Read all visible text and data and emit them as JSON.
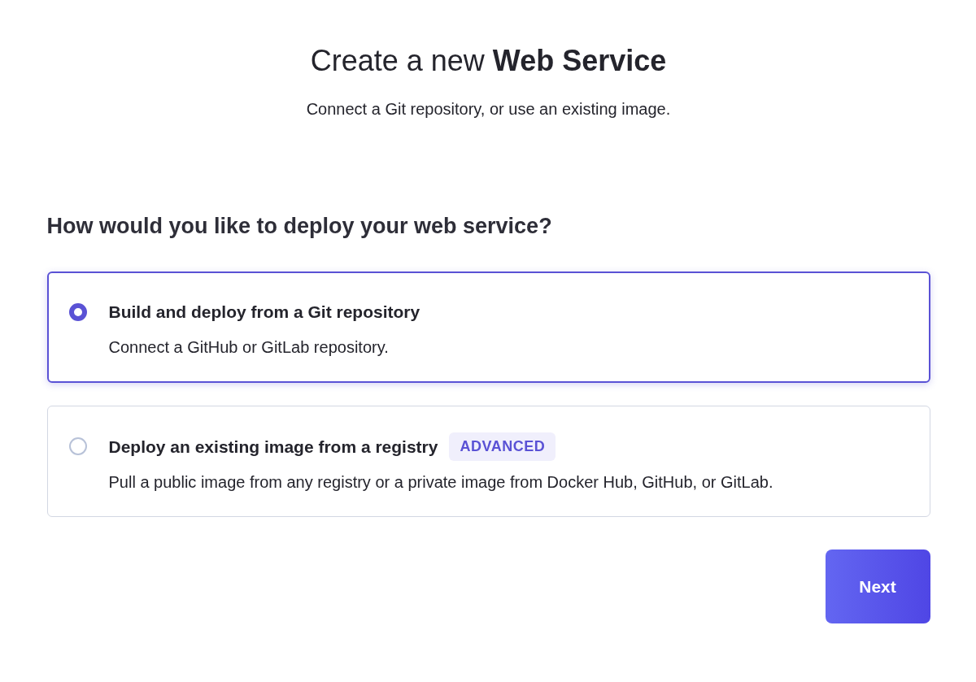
{
  "header": {
    "title": "Create a new **Web Service**",
    "subtitle": "Connect a Git repository, or use an existing image."
  },
  "question": "How would you like to deploy your web service?",
  "options": [
    {
      "title": "Build and deploy from a Git repository",
      "description": "Connect a GitHub or GitLab repository.",
      "selected": true
    },
    {
      "title": "Deploy an existing image from a registry",
      "badge": "ADVANCED",
      "description": "Pull a public image from any registry or a private image from Docker Hub, GitHub, or GitLab.",
      "selected": false
    }
  ],
  "next_button": "Next"
}
